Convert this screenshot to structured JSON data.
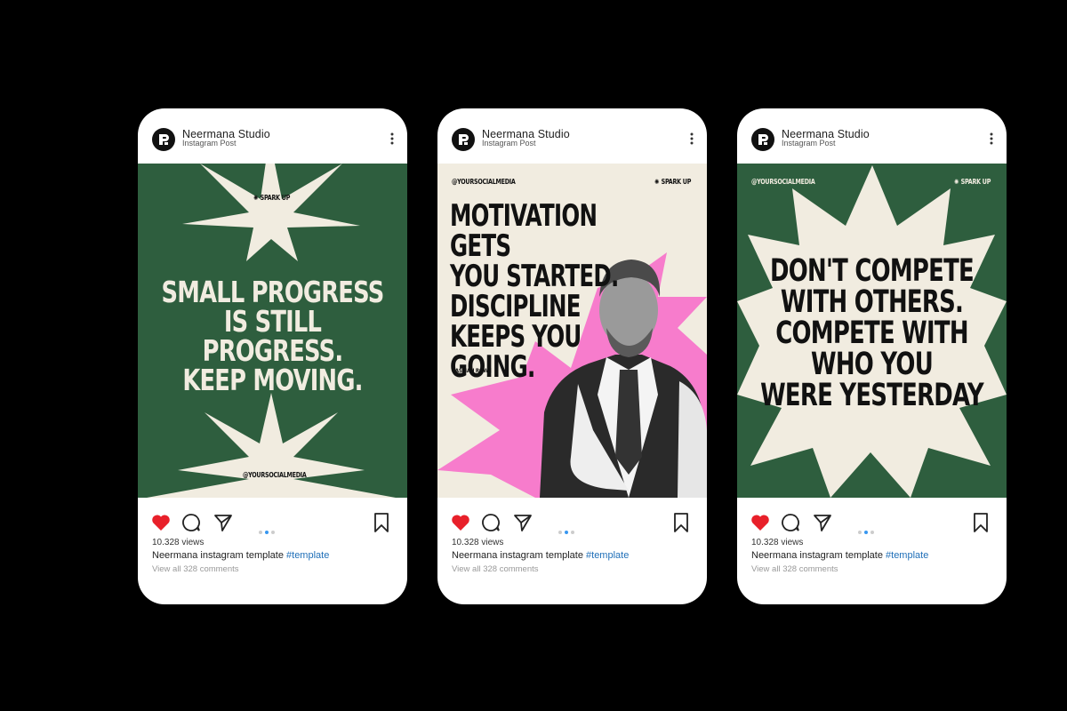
{
  "colors": {
    "background": "#000000",
    "green": "#2e5e3e",
    "cream": "#f1ece0",
    "pink": "#f77ccc",
    "heart": "#e8202a",
    "link": "#1f6fb8"
  },
  "icons": {
    "avatar": "studio-logo-icon",
    "more": "more-vertical-icon",
    "like": "heart-icon",
    "comment": "comment-icon",
    "share": "send-icon",
    "save": "bookmark-icon"
  },
  "posts": [
    {
      "account_name": "Neermana Studio",
      "account_subtitle": "Instagram Post",
      "spark_label": "SPARK UP",
      "handle": "@YOURSOCIALMEDIA",
      "quote": "SMALL PROGRESS\nIS STILL PROGRESS.\nKEEP MOVING.",
      "views": "10.328 views",
      "caption_user": "Neermana",
      "caption_text": " instagram template ",
      "hashtag": "#template",
      "comments": "View all 328 comments",
      "carousel_active_index": 1
    },
    {
      "account_name": "Neermana Studio",
      "account_subtitle": "Instagram Post",
      "spark_label": "SPARK UP",
      "handle": "@YOURSOCIALMEDIA",
      "quote": "MOTIVATION GETS\nYOU STARTED.\nDISCIPLINE\nKEEPS YOU\nGOING.",
      "author": "CASSIAN ROWE",
      "views": "10.328 views",
      "caption_user": "Neermana",
      "caption_text": " instagram template ",
      "hashtag": "#template",
      "comments": "View all 328 comments",
      "carousel_active_index": 1
    },
    {
      "account_name": "Neermana Studio",
      "account_subtitle": "Instagram Post",
      "spark_label": "SPARK UP",
      "handle": "@YOURSOCIALMEDIA",
      "quote": "DON'T COMPETE\nWITH OTHERS.\nCOMPETE WITH\nWHO YOU\nWERE YESTERDAY",
      "views": "10.328 views",
      "caption_user": "Neermana",
      "caption_text": " instagram template ",
      "hashtag": "#template",
      "comments": "View all 328 comments",
      "carousel_active_index": 1
    }
  ]
}
